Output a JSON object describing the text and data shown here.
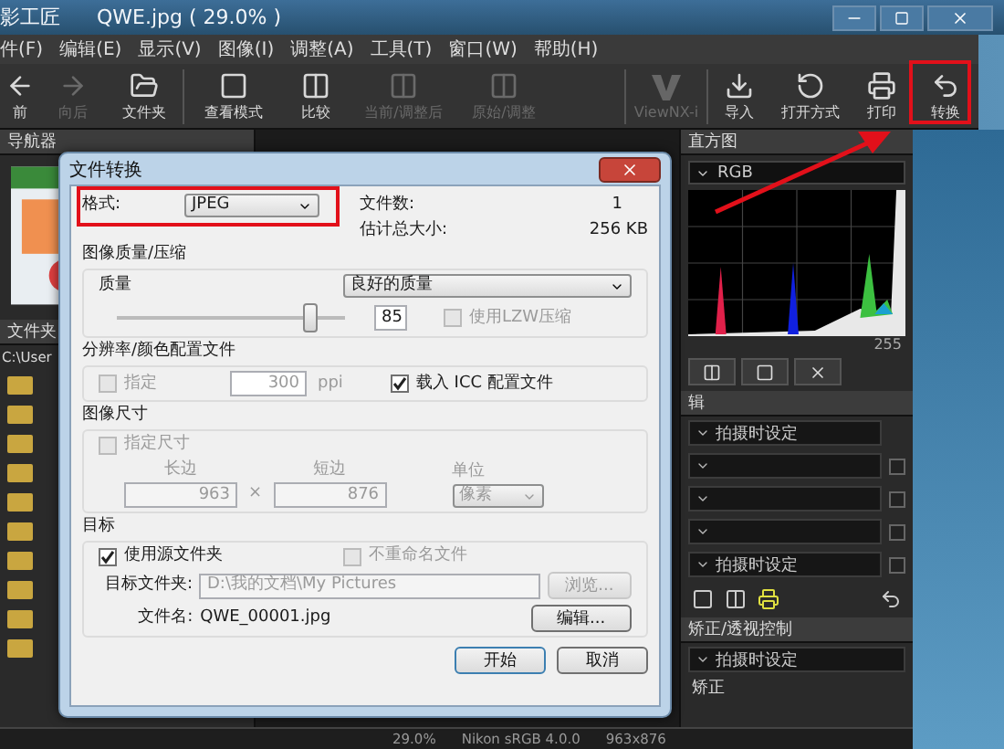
{
  "title_bar": {
    "app_title": "影工匠",
    "document_title": "QWE.jpg ( 29.0% )"
  },
  "menu": [
    "件(F)",
    "编辑(E)",
    "显示(V)",
    "图像(I)",
    "调整(A)",
    "工具(T)",
    "窗口(W)",
    "帮助(H)"
  ],
  "toolbar": [
    {
      "kind": "back",
      "label": "前",
      "disabled": false
    },
    {
      "kind": "forward",
      "label": "向后",
      "disabled": true
    },
    {
      "kind": "folder",
      "label": "文件夹",
      "disabled": false
    },
    {
      "kind": "view",
      "label": "查看模式",
      "disabled": false
    },
    {
      "kind": "compare",
      "label": "比较",
      "disabled": false
    },
    {
      "kind": "before",
      "label": "当前/调整后",
      "disabled": true
    },
    {
      "kind": "original",
      "label": "原始/调整",
      "disabled": true
    },
    {
      "kind": "logo",
      "label": "ViewNX-i",
      "disabled": true
    },
    {
      "kind": "import",
      "label": "导入",
      "disabled": false
    },
    {
      "kind": "open",
      "label": "打开方式",
      "disabled": false
    },
    {
      "kind": "print",
      "label": "打印",
      "disabled": false
    },
    {
      "kind": "convert",
      "label": "转换",
      "disabled": false
    }
  ],
  "navigator_panel": {
    "title": "导航器"
  },
  "folder_panel": {
    "title": "文件夹",
    "path": "C:\\User"
  },
  "histogram_panel": {
    "title": "直方图",
    "channel": "RGB",
    "max_label": "255"
  },
  "edit_panel": {
    "title": "辑",
    "rows": [
      {
        "kind": "plain",
        "label": "拍摄时设定"
      },
      {
        "kind": "check",
        "checked": false
      },
      {
        "kind": "check",
        "checked": false
      },
      {
        "kind": "check",
        "checked": false
      },
      {
        "kind": "check",
        "label": "拍摄时设定",
        "checked": false
      }
    ]
  },
  "correction_panel": {
    "title": "矫正/透视控制",
    "preset": "拍摄时设定",
    "item": "矫正"
  },
  "status_bar": [
    "29.0%",
    "Nikon sRGB 4.0.0",
    "963x876"
  ],
  "dialog": {
    "title": "文件转换",
    "format_label": "格式:",
    "format": "JPEG",
    "file_count_label": "文件数:",
    "file_count": "1",
    "size_label": "估计总大小:",
    "size": "256 KB",
    "quality_section": "图像质量/压缩",
    "quality_label": "质量",
    "quality": "良好的质量",
    "quality_slider": {
      "level": 0.85
    },
    "quality_value": "85",
    "lzw": {
      "label": "使用LZW压缩",
      "checked": false,
      "disabled": true
    },
    "resolution_section": "分辨率/颜色配置文件",
    "specify": {
      "label": "指定",
      "checked": false,
      "disabled": true
    },
    "ppi_value": "300",
    "ppi_unit": "ppi",
    "icc": {
      "label": "载入 ICC 配置文件",
      "checked": true,
      "disabled": false
    },
    "size_section": "图像尺寸",
    "specify_size": {
      "label": "指定尺寸",
      "checked": false,
      "disabled": true
    },
    "long_label": "长边",
    "long_value": "963",
    "times": "×",
    "short_label": "短边",
    "short_value": "876",
    "unit_label": "单位",
    "unit": "像素",
    "target_section": "目标",
    "use_source": {
      "label": "使用源文件夹",
      "checked": true,
      "disabled": false
    },
    "no_rename": {
      "label": "不重命名文件",
      "checked": false,
      "disabled": true
    },
    "folder_label": "目标文件夹:",
    "folder": "D:\\我的文档\\My Pictures",
    "browse": {
      "label": "浏览...",
      "disabled": true
    },
    "filename_label": "文件名:",
    "filename": "QWE_00001.jpg",
    "edit_button": "编辑...",
    "buttons": [
      "开始",
      "取消"
    ]
  }
}
